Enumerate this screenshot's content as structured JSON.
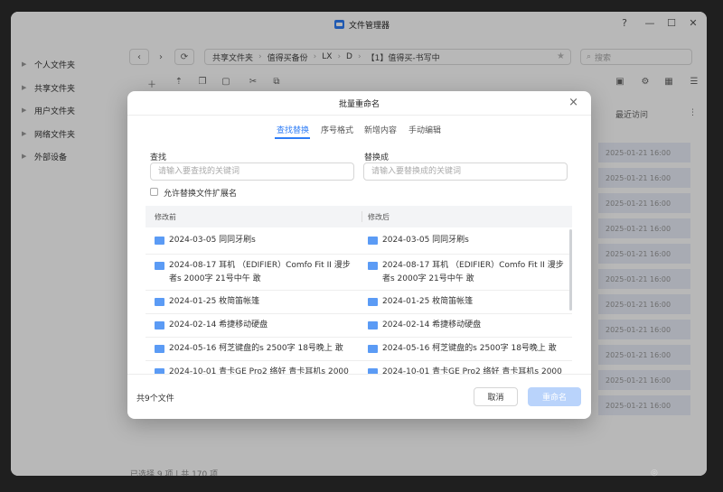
{
  "window": {
    "title": "文件管理器",
    "help": "?",
    "minimize": "—",
    "maximize": "☐",
    "close": "✕"
  },
  "sidebar": {
    "items": [
      {
        "label": "个人文件夹"
      },
      {
        "label": "共享文件夹"
      },
      {
        "label": "用户文件夹"
      },
      {
        "label": "网络文件夹"
      },
      {
        "label": "外部设备"
      }
    ]
  },
  "toolbar": {
    "back": "‹",
    "forward": "›",
    "refresh": "⟳",
    "path": [
      "共享文件夹",
      "值得买备份",
      "LX",
      "D",
      "【1】值得买-书写中"
    ],
    "search_placeholder": "搜索"
  },
  "columns": {
    "recent": "最近访问"
  },
  "background_rows": [
    "2025-01-21 16:00",
    "2025-01-21 16:00",
    "2025-01-21 16:00",
    "2025-01-21 16:00",
    "2025-01-21 16:00",
    "2025-01-21 16:00",
    "2025-01-21 16:00",
    "2025-01-21 16:00",
    "2025-01-21 16:00",
    "2025-01-21 16:00",
    "2025-01-21 16:00"
  ],
  "status": "已选择 9 项 | 共 170 项",
  "dialog": {
    "title": "批量重命名",
    "tabs": [
      "查找替换",
      "序号格式",
      "新增内容",
      "手动编辑"
    ],
    "find_label": "查找",
    "find_placeholder": "请输入要查找的关键词",
    "replace_label": "替换成",
    "replace_placeholder": "请输入要替换成的关键词",
    "ext_checkbox": "允许替换文件扩展名",
    "col_before": "修改前",
    "col_after": "修改后",
    "rows": [
      {
        "before": "2024-03-05 同同牙刷s",
        "after": "2024-03-05 同同牙刷s"
      },
      {
        "before": "2024-08-17 耳机 （EDIFIER）Comfo Fit II  漫步者s  2000字 21号中午 敢",
        "after": "2024-08-17 耳机 （EDIFIER）Comfo Fit II  漫步者s  2000字 21号中午 敢"
      },
      {
        "before": "2024-01-25 枚简笛帐篷",
        "after": "2024-01-25 枚简笛帐篷"
      },
      {
        "before": "2024-02-14 希捷移动硬盘",
        "after": "2024-02-14 希捷移动硬盘"
      },
      {
        "before": "2024-05-16 柯芝键盘的s  2500字 18号晚上  敢",
        "after": "2024-05-16 柯芝键盘的s  2500字 18号晚上  敢"
      },
      {
        "before": "2024-10-01 青卡GE Pro2  络好  青卡耳机s  2000",
        "after": "2024-10-01 青卡GE Pro2  络好  青卡耳机s  2000"
      }
    ],
    "file_count": "共9个文件",
    "cancel": "取消",
    "confirm": "重命名"
  }
}
